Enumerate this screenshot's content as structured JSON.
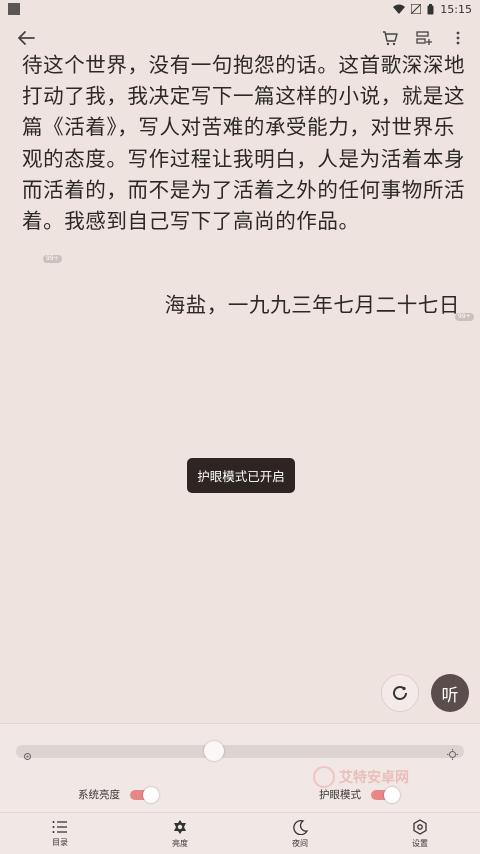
{
  "status_bar": {
    "time": "15:15"
  },
  "reading": {
    "paragraph": "待这个世界，没有一句抱怨的话。这首歌深深地打动了我，我决定写下一篇这样的小说，就是这篇《活着》，写人对苦难的承受能力，对世界乐观的态度。写作过程让我明白，人是为活着本身而活着的，而不是为了活着之外的任何事物所活着。我感到自己写下了高尚的作品。",
    "paragraph_badge": "99+",
    "signature": "海盐，一九九三年七月二十七日",
    "signature_badge": "99+"
  },
  "toast": {
    "text": "护眼模式已开启"
  },
  "float": {
    "listen_label": "听"
  },
  "brightness": {
    "level": 0.44,
    "system_brightness_label": "系统亮度",
    "system_brightness_on": true,
    "eye_care_label": "护眼模式",
    "eye_care_on": true
  },
  "watermark": {
    "text": "艾特安卓网"
  },
  "bottom_nav": {
    "items": [
      {
        "label": "目录",
        "icon": "list-icon"
      },
      {
        "label": "亮度",
        "icon": "brightness-icon"
      },
      {
        "label": "夜间",
        "icon": "moon-icon"
      },
      {
        "label": "设置",
        "icon": "gear-icon"
      }
    ]
  },
  "colors": {
    "background": "#efe3e0",
    "toast": "#2e2422",
    "toggle_on": "#e58886",
    "listen_button": "#5b4d4b"
  }
}
